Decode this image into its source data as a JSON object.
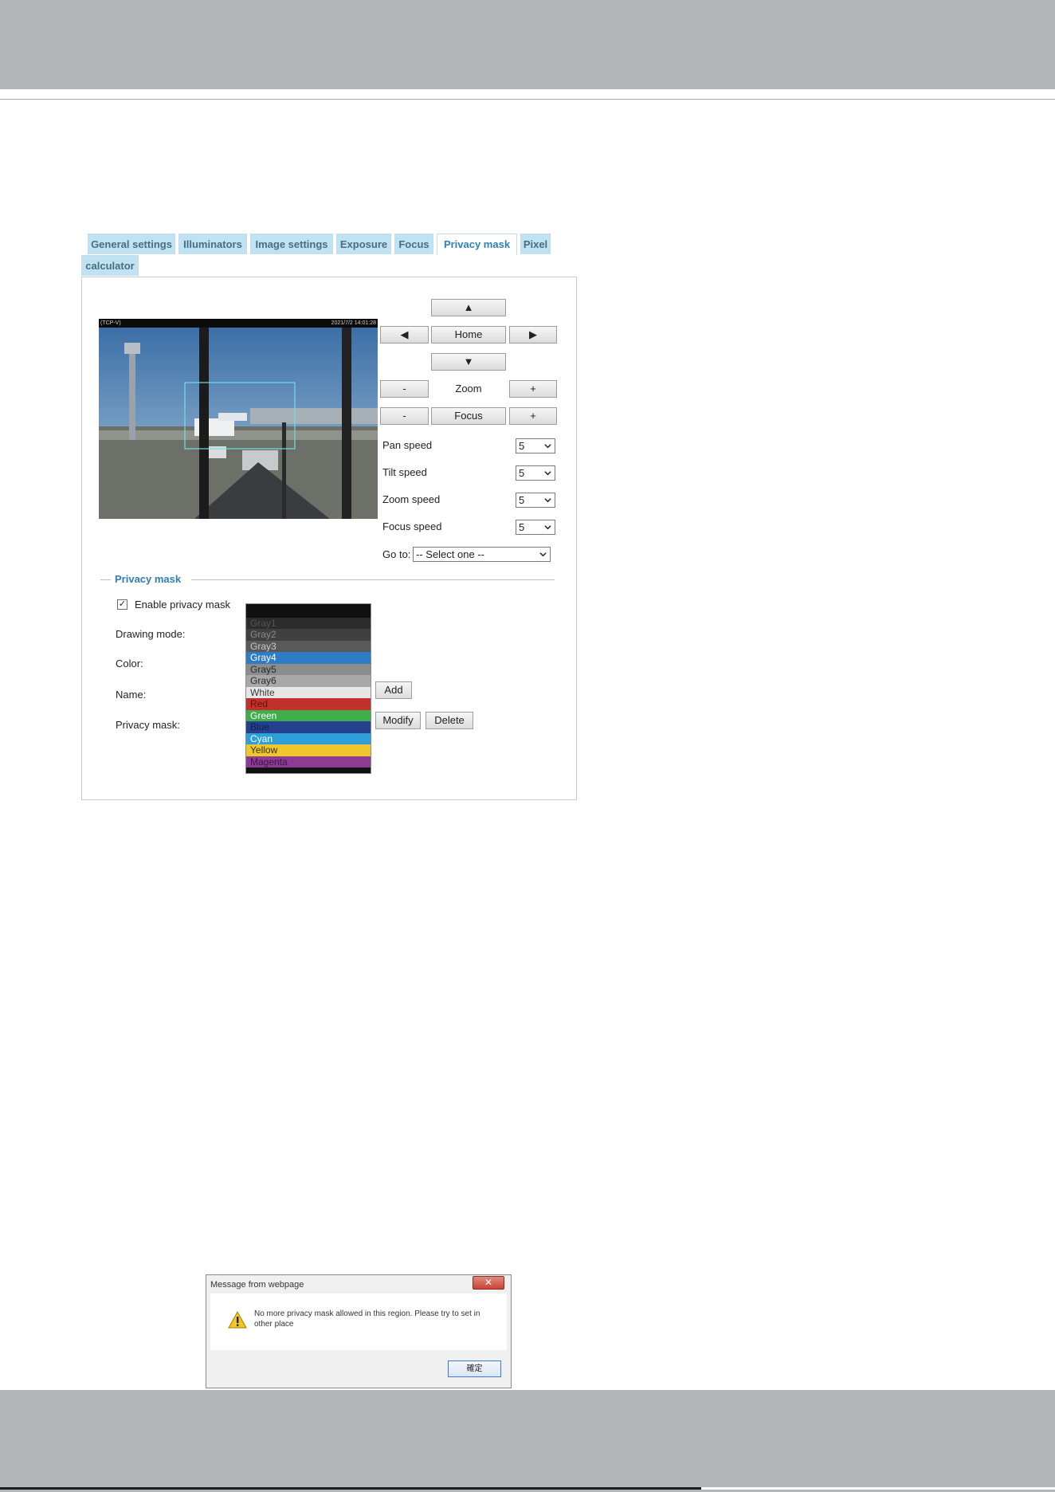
{
  "tabs": [
    {
      "label": "General settings"
    },
    {
      "label": "Illuminators"
    },
    {
      "label": "Image settings"
    },
    {
      "label": "Exposure"
    },
    {
      "label": "Focus"
    },
    {
      "label": "Privacy mask",
      "active": true
    },
    {
      "label": "Pixel"
    },
    {
      "label": "calculator"
    }
  ],
  "video": {
    "label_left": "(TCP-V)",
    "timestamp": "2021/7/2 14:01:28"
  },
  "ptz": {
    "up": "▲",
    "left": "◀",
    "home": "Home",
    "right": "▶",
    "down": "▼",
    "zoom_minus": "-",
    "zoom_label": "Zoom",
    "zoom_plus": "+",
    "focus_minus": "-",
    "focus_label": "Focus",
    "focus_plus": "+"
  },
  "speeds": [
    {
      "label": "Pan speed",
      "value": "5"
    },
    {
      "label": "Tilt speed",
      "value": "5"
    },
    {
      "label": "Zoom speed",
      "value": "5"
    },
    {
      "label": "Focus speed",
      "value": "5"
    }
  ],
  "goto": {
    "label": "Go to:",
    "value": "-- Select one --"
  },
  "privacy": {
    "legend": "Privacy mask",
    "enable_label": "Enable privacy mask",
    "enable_checked": "✓",
    "drawing_mode_label": "Drawing mode:",
    "color_label": "Color:",
    "name_label": "Name:",
    "mask_label": "Privacy mask:",
    "add_button": "Add",
    "modify_button": "Modify",
    "delete_button": "Delete"
  },
  "color_options": [
    {
      "label": "",
      "bg": "#111111",
      "fg": "#111111"
    },
    {
      "label": "Gray1",
      "bg": "#2c2c2c",
      "fg": "#555555"
    },
    {
      "label": "Gray2",
      "bg": "#404040",
      "fg": "#8a8a8a"
    },
    {
      "label": "Gray3",
      "bg": "#595959",
      "fg": "#c8c8c8"
    },
    {
      "label": "Gray4",
      "bg": "#2f7cc6",
      "fg": "#ffffff",
      "selected": true
    },
    {
      "label": "Gray5",
      "bg": "#8c8c8c",
      "fg": "#2b2b2b"
    },
    {
      "label": "Gray6",
      "bg": "#a8a8a8",
      "fg": "#2b2b2b"
    },
    {
      "label": "White",
      "bg": "#e6e6e6",
      "fg": "#3a3a3a"
    },
    {
      "label": "Red",
      "bg": "#c1302b",
      "fg": "#5e1512"
    },
    {
      "label": "Green",
      "bg": "#3fad49",
      "fg": "#ffffff"
    },
    {
      "label": "Blue",
      "bg": "#24408f",
      "fg": "#0f1f4d"
    },
    {
      "label": "Cyan",
      "bg": "#2e9fd9",
      "fg": "#ffffff"
    },
    {
      "label": "Yellow",
      "bg": "#efc62c",
      "fg": "#3a3000"
    },
    {
      "label": "Magenta",
      "bg": "#8e3b95",
      "fg": "#3b1640"
    }
  ],
  "dialog": {
    "title": "Message from webpage",
    "close": "✕",
    "message": "No more privacy mask allowed in this region. Please try to set in other place",
    "ok_button": "確定"
  }
}
